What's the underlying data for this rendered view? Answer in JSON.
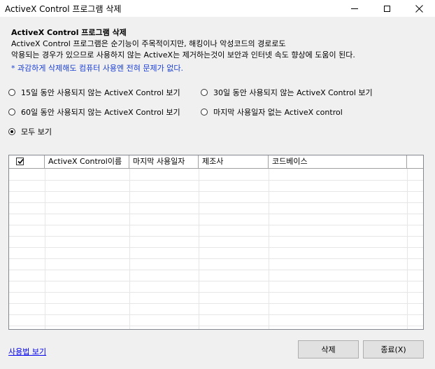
{
  "window": {
    "title": "ActiveX Control 프로그램 삭제"
  },
  "header": {
    "title": "ActiveX Control 프로그램 삭제",
    "desc_line1": "ActiveX Control 프로그램은 순기능이 주목적이지만, 해킹이나 악성코드의 경로로도",
    "desc_line2": "악용되는 경우가 있으므로 사용하지 않는 ActiveX는 제거하는것이 보안과 인터넷 속도 향상에 도움이 된다.",
    "warning": "* 과감하게 삭제해도 컴퓨터 사용엔 전혀 문제가 없다."
  },
  "filters": {
    "options": [
      {
        "label": "15일 동안 사용되지 않는 ActiveX Control 보기",
        "checked": false
      },
      {
        "label": "30일 동안 사용되지 않는 ActiveX Control 보기",
        "checked": false
      },
      {
        "label": "60일 동안 사용되지 않는 ActiveX Control 보기",
        "checked": false
      },
      {
        "label": "마지막 사용일자 없는 ActiveX control",
        "checked": false
      },
      {
        "label": "모두 보기",
        "checked": true
      }
    ]
  },
  "grid": {
    "header_checked": true,
    "columns": [
      "ActiveX Control이름",
      "마지막 사용일자",
      "제조사",
      "코드베이스"
    ],
    "rows": []
  },
  "footer": {
    "help_link": "사용법 보기",
    "delete_label": "삭제",
    "close_label": "종료(X)"
  },
  "colors": {
    "warning": "#1a3fd6",
    "link": "#0000ee"
  }
}
